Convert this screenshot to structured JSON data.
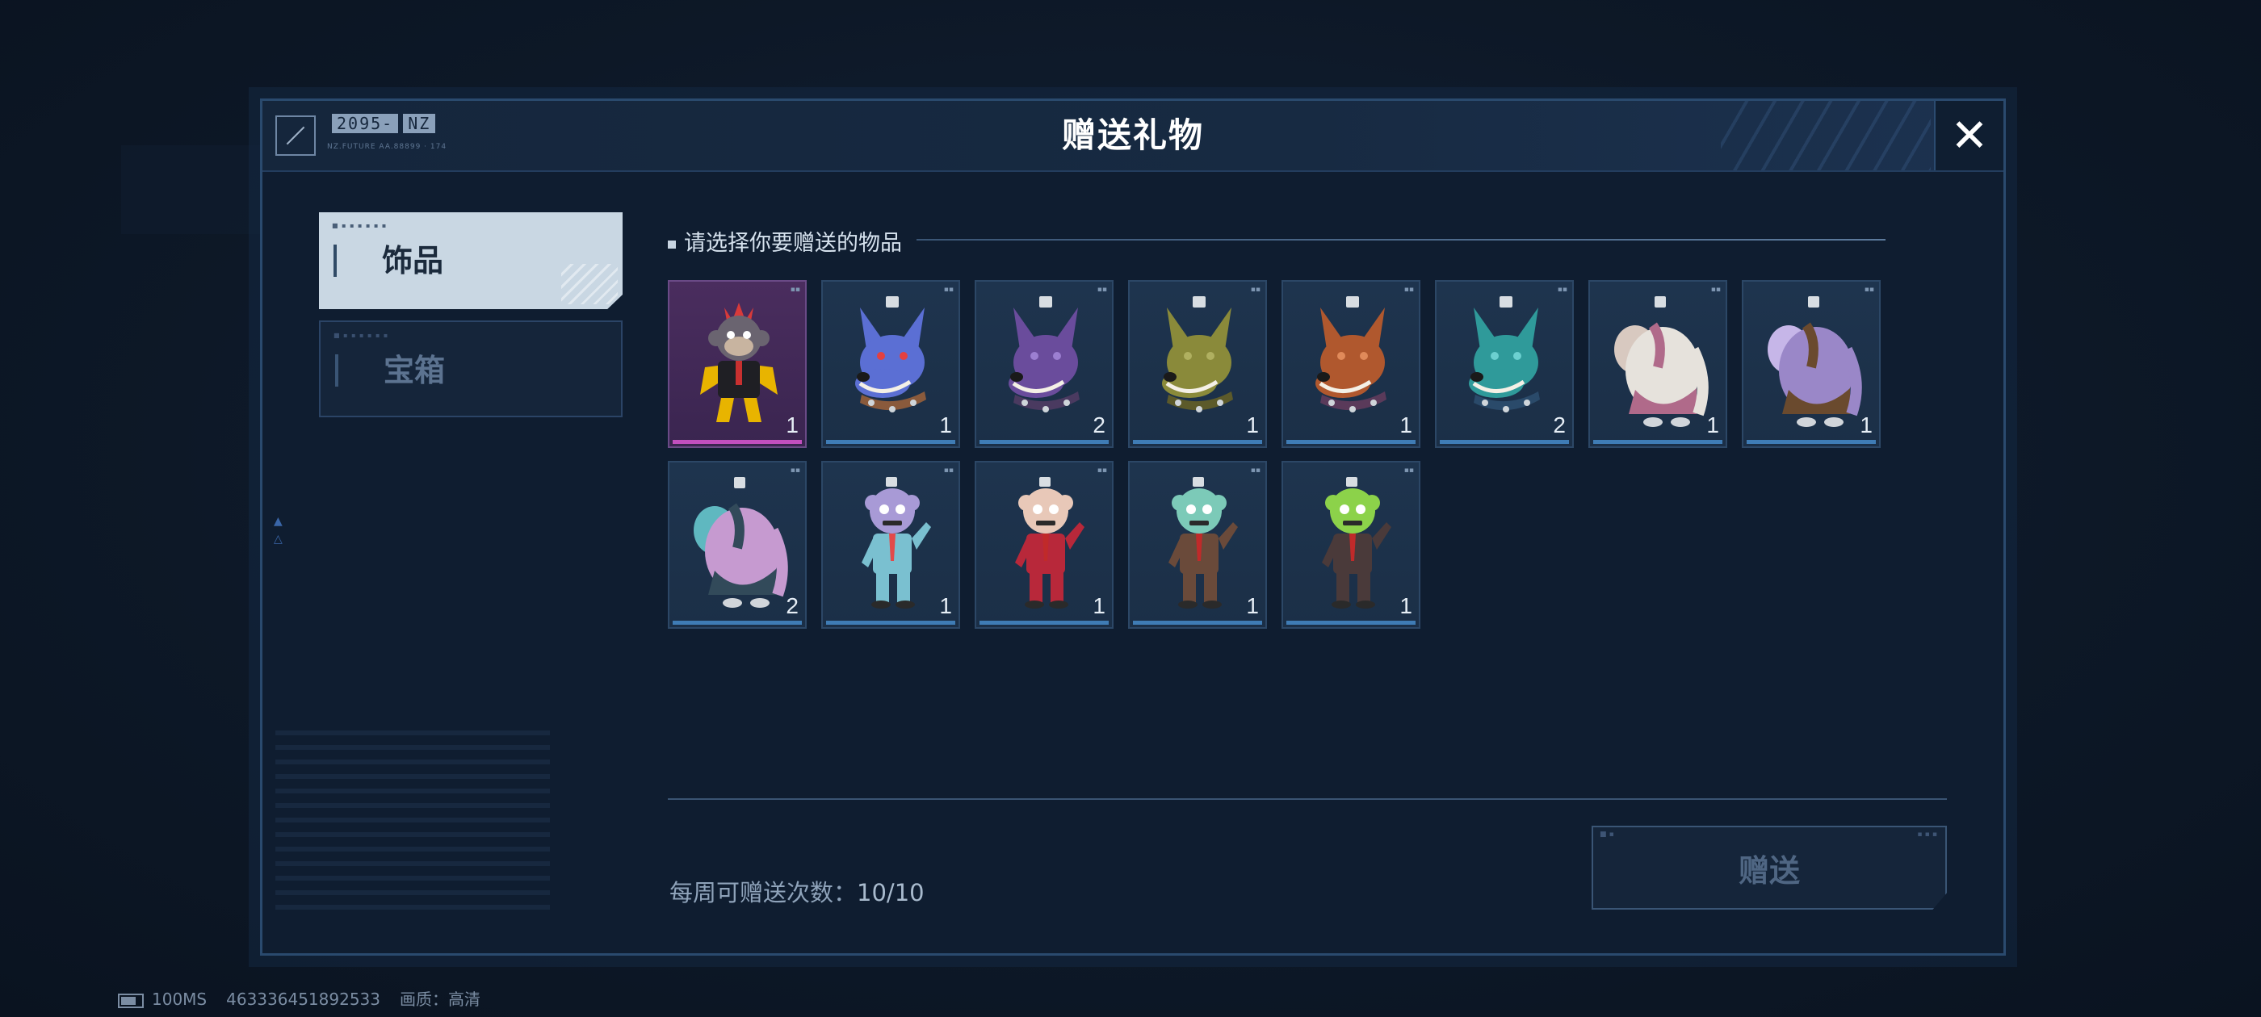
{
  "dialog": {
    "title": "赠送礼物",
    "brand_code": "2095-",
    "brand_tag": "NZ",
    "brand_sub": "NZ.FUTURE AA.88899 · 174",
    "close_symbol": "✕"
  },
  "tabs": [
    {
      "label": "饰品",
      "active": true
    },
    {
      "label": "宝箱",
      "active": false
    }
  ],
  "section_title": "请选择你要赠送的物品",
  "items": [
    {
      "name": "demon-monkey-charm",
      "qty": "1",
      "selected": true
    },
    {
      "name": "blue-dog-charm",
      "qty": "1",
      "selected": false
    },
    {
      "name": "purple-dog-charm",
      "qty": "2",
      "selected": false
    },
    {
      "name": "olive-dog-charm",
      "qty": "1",
      "selected": false
    },
    {
      "name": "orange-dog-charm",
      "qty": "1",
      "selected": false
    },
    {
      "name": "teal-dog-charm",
      "qty": "2",
      "selected": false
    },
    {
      "name": "white-elephant-charm",
      "qty": "1",
      "selected": false
    },
    {
      "name": "brown-elephant-charm",
      "qty": "1",
      "selected": false
    },
    {
      "name": "dark-elephant-charm",
      "qty": "2",
      "selected": false
    },
    {
      "name": "lavender-zombie-charm",
      "qty": "1",
      "selected": false
    },
    {
      "name": "red-zombie-charm",
      "qty": "1",
      "selected": false
    },
    {
      "name": "teal-zombie-charm",
      "qty": "1",
      "selected": false
    },
    {
      "name": "green-zombie-charm",
      "qty": "1",
      "selected": false
    }
  ],
  "weekly": {
    "label": "每周可赠送次数：",
    "value": "10/10"
  },
  "gift_button": "赠送",
  "status": {
    "ping": "100MS",
    "id": "463336451892533",
    "quality_label": "画质：",
    "quality_value": "高清"
  },
  "colors": {
    "selected_bar": "#c24fbf",
    "normal_bar": "#3f7cb5",
    "background": "#0f1d30"
  }
}
